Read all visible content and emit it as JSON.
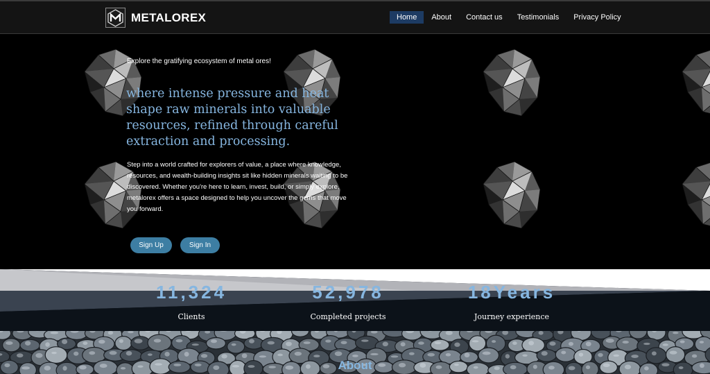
{
  "header": {
    "brand": "METALOREX",
    "nav": [
      {
        "label": "Home",
        "active": true
      },
      {
        "label": "About"
      },
      {
        "label": "Contact us"
      },
      {
        "label": "Testimonials"
      },
      {
        "label": "Privacy Policy"
      }
    ]
  },
  "hero": {
    "eyebrow": "Explore the gratifying ecosystem of metal ores!",
    "headline": "where intense pressure and heat shape raw minerals into valuable resources, refined through careful extraction and processing.",
    "body": "Step into a world crafted for explorers of value,  a place where knowledge, resources, and wealth-building insights sit like hidden minerals waiting to be discovered. Whether you're here to learn, invest, build, or simply explore, metalorex offers a space designed to help you uncover the gems that move you forward.",
    "signup": "Sign Up",
    "signin": "Sign In"
  },
  "stats": [
    {
      "value": "11,324",
      "label": "Clients"
    },
    {
      "value": "52,978",
      "label": "Completed projects"
    },
    {
      "value": "18Years",
      "label": "Journey experience"
    }
  ],
  "about": {
    "title": "About"
  },
  "colors": {
    "accent": "#86b6e0",
    "button": "#3d7ea3",
    "nav_active": "#1d3b63"
  }
}
